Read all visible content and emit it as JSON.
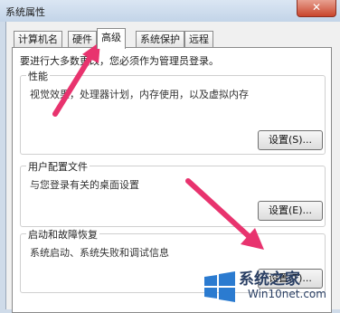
{
  "window": {
    "title": "系统属性",
    "close_glyph": "✕"
  },
  "tabs": [
    {
      "label": "计算机名",
      "active": false
    },
    {
      "label": "硬件",
      "active": false
    },
    {
      "label": "高级",
      "active": true
    },
    {
      "label": "系统保护",
      "active": false
    },
    {
      "label": "远程",
      "active": false
    }
  ],
  "notice": "要进行大多数更改，您必须作为管理员登录。",
  "groups": {
    "performance": {
      "title": "性能",
      "description": "视觉效果，处理器计划，内存使用，以及虚拟内存",
      "button": "设置(S)..."
    },
    "user_profiles": {
      "title": "用户配置文件",
      "description": "与您登录有关的桌面设置",
      "button": "设置(E)..."
    },
    "startup_recovery": {
      "title": "启动和故障恢复",
      "description": "系统启动、系统失败和调试信息",
      "button": "设置(T)..."
    }
  },
  "annotations": {
    "arrow_color": "#e8336e"
  },
  "watermark": {
    "line1": "系统之家",
    "line2": "Win10net.com"
  }
}
